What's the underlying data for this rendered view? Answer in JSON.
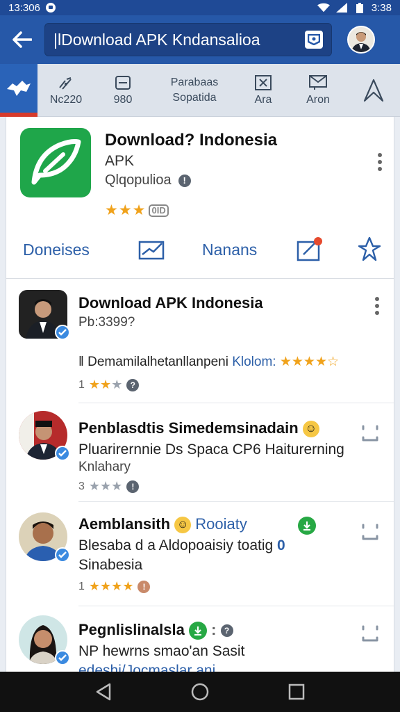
{
  "status_bar": {
    "time_left": "13:306",
    "time_right": "3:38"
  },
  "app_bar": {
    "search_text": "|lDownload APK Kndansalioa"
  },
  "categories": [
    {
      "label": "Nc220",
      "icon": "signal-icon"
    },
    {
      "label": "980",
      "icon": "tray-icon"
    },
    {
      "label": "Parabaas\nSopatida",
      "icon": "none"
    },
    {
      "label": "Ara",
      "icon": "box-x-icon"
    },
    {
      "label": "Aron",
      "icon": "mail-icon"
    },
    {
      "label": "",
      "icon": "tent-icon"
    }
  ],
  "app": {
    "title": "Download? Indonesia",
    "subtitle": "APK",
    "publisher": "Qlqopulioa",
    "stars": "★★★",
    "rating_count": "0ID",
    "actions": {
      "left_label": "Doneises",
      "mid_label": "Nanans"
    }
  },
  "reviews": [
    {
      "name": "Download APK Indonesia",
      "line1": "Pb:3399?",
      "line2_prefix": "Demamilalhetanllanpeni",
      "line2_link": "Klolom:",
      "meta_prefix": "1",
      "stars_on": "★★",
      "stars_off": "★",
      "top_stars": "★★★★",
      "top_off": "☆"
    },
    {
      "name": "Penblasdtis Simedemsinadain",
      "line1": "Pluarirernnie Ds Spaca CP6 Haiturerning",
      "line2": "Knlahary",
      "meta_prefix": "3",
      "stars_on": "",
      "stars_off": "★★★"
    },
    {
      "name": "Aemblansith",
      "name_link": "Rooiaty",
      "line1": "Blesaba d a Aldopoaisiy toatig",
      "line1_badge": "0",
      "line2": "Sinabesia",
      "meta_prefix": "1",
      "stars_on": "★★★",
      "stars_off": "★"
    },
    {
      "name": "Pegnlislinalsla",
      "line1": "NP hewrns smao'an Sasit",
      "line2": "edeshi/Jocmaslar ani"
    }
  ],
  "colors": {
    "primary": "#2658a8",
    "accent": "#f0a21b",
    "app_icon": "#1fa64a"
  }
}
